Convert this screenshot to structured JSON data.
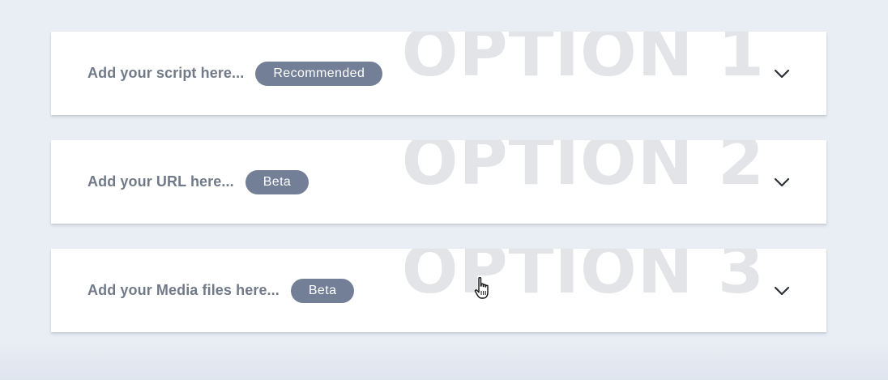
{
  "options": [
    {
      "watermark": "OPTION 1",
      "label": "Add your script here...",
      "badge": "Recommended",
      "expand_icon": "chevron-down-icon"
    },
    {
      "watermark": "OPTION 2",
      "label": "Add your URL here...",
      "badge": "Beta",
      "expand_icon": "chevron-down-icon"
    },
    {
      "watermark": "OPTION 3",
      "label": "Add your Media files here...",
      "badge": "Beta",
      "expand_icon": "chevron-down-icon"
    }
  ],
  "cursor_icon": "hand-pointer-icon",
  "colors": {
    "background": "#e9eef5",
    "card": "#ffffff",
    "label_text": "#717a88",
    "badge_bg": "#737f96",
    "badge_text": "#ffffff",
    "watermark_text": "#e3e4e8",
    "chevron": "#2b2f36"
  }
}
